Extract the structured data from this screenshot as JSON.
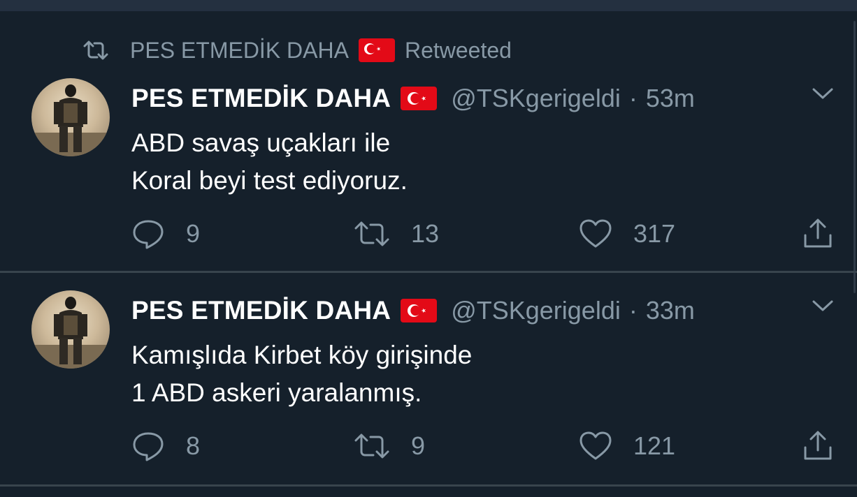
{
  "colors": {
    "background": "#15202b",
    "text_primary": "#ffffff",
    "text_secondary": "#8899a6",
    "divider": "#38444d",
    "flag_red": "#e30a17"
  },
  "retweet_context": {
    "name": "PES ETMEDİK DAHA",
    "flag": "turkey-flag-icon",
    "label": "Retweeted",
    "icon": "retweet-icon"
  },
  "tweets": [
    {
      "avatar": "avatar-image",
      "display_name": "PES ETMEDİK DAHA",
      "handle": "@TSKgerigeldi",
      "separator": "·",
      "time": "53m",
      "text_lines": [
        "ABD savaş uçakları ile",
        "Koral beyi test ediyoruz."
      ],
      "reply_count": "9",
      "retweet_count": "13",
      "like_count": "317"
    },
    {
      "avatar": "avatar-image",
      "display_name": "PES ETMEDİK DAHA",
      "handle": "@TSKgerigeldi",
      "separator": "·",
      "time": "33m",
      "text_lines": [
        "Kamışlıda Kirbet köy girişinde",
        "1 ABD askeri yaralanmış."
      ],
      "reply_count": "8",
      "retweet_count": "9",
      "like_count": "121"
    }
  ]
}
